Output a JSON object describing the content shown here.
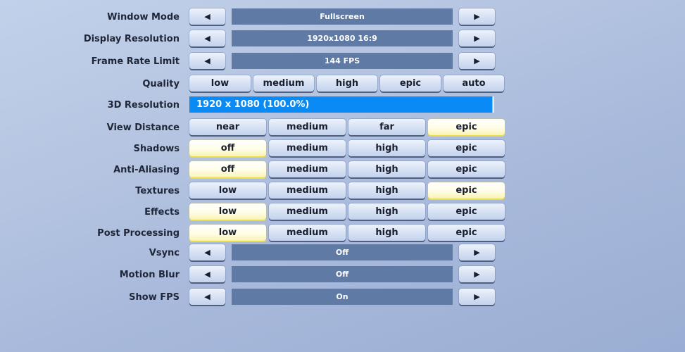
{
  "settings": {
    "window_mode": {
      "label": "Window Mode",
      "value": "Fullscreen"
    },
    "display_resolution": {
      "label": "Display Resolution",
      "value": "1920x1080 16:9"
    },
    "frame_rate_limit": {
      "label": "Frame Rate Limit",
      "value": "144 FPS"
    },
    "quality": {
      "label": "Quality",
      "options": [
        "low",
        "medium",
        "high",
        "epic",
        "auto"
      ],
      "selected": null
    },
    "resolution_3d": {
      "label": "3D Resolution",
      "value": "1920 x 1080 (100.0%)",
      "percent": 100
    },
    "view_distance": {
      "label": "View Distance",
      "options": [
        "near",
        "medium",
        "far",
        "epic"
      ],
      "selected": "epic"
    },
    "shadows": {
      "label": "Shadows",
      "options": [
        "off",
        "medium",
        "high",
        "epic"
      ],
      "selected": "off"
    },
    "anti_aliasing": {
      "label": "Anti-Aliasing",
      "options": [
        "off",
        "medium",
        "high",
        "epic"
      ],
      "selected": "off"
    },
    "textures": {
      "label": "Textures",
      "options": [
        "low",
        "medium",
        "high",
        "epic"
      ],
      "selected": "epic"
    },
    "effects": {
      "label": "Effects",
      "options": [
        "low",
        "medium",
        "high",
        "epic"
      ],
      "selected": "low"
    },
    "post_processing": {
      "label": "Post Processing",
      "options": [
        "low",
        "medium",
        "high",
        "epic"
      ],
      "selected": "low"
    },
    "vsync": {
      "label": "Vsync",
      "value": "Off"
    },
    "motion_blur": {
      "label": "Motion Blur",
      "value": "Off"
    },
    "show_fps": {
      "label": "Show FPS",
      "value": "On"
    }
  },
  "icons": {
    "prev": "◀",
    "next": "▶"
  },
  "colors": {
    "selected": "#fffde6",
    "value_bar": "#5f7aa5",
    "resolution_bar": "#0a8af5"
  }
}
